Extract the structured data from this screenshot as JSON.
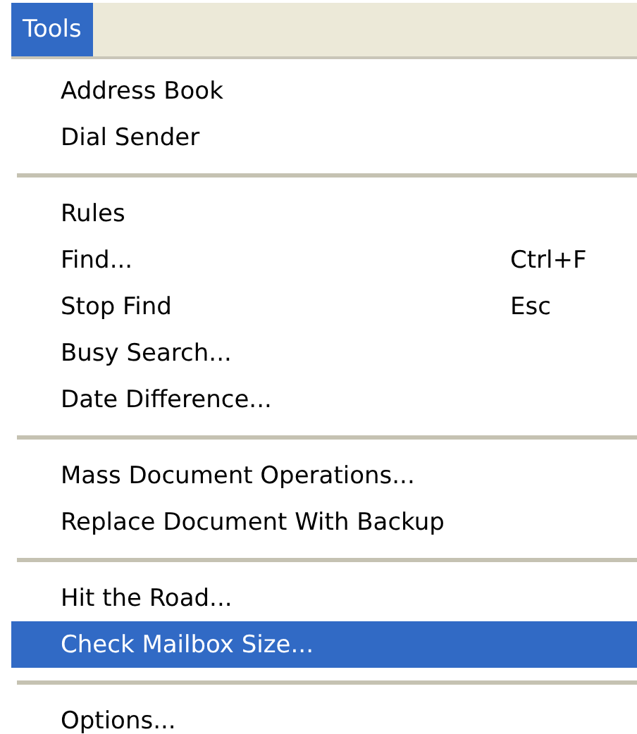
{
  "menu_bar": [
    {
      "label": "Tools",
      "selected": true
    }
  ],
  "menu": {
    "items": [
      {
        "kind": "item",
        "label": "Address Book",
        "selected": false
      },
      {
        "kind": "item",
        "label": "Dial Sender",
        "selected": false
      },
      {
        "kind": "separator"
      },
      {
        "kind": "item",
        "label": "Rules",
        "selected": false
      },
      {
        "kind": "item",
        "label": "Find...",
        "shortcut": "Ctrl+F",
        "selected": false
      },
      {
        "kind": "item",
        "label": "Stop Find",
        "shortcut": "Esc",
        "selected": false
      },
      {
        "kind": "item",
        "label": "Busy Search...",
        "selected": false
      },
      {
        "kind": "item",
        "label": "Date Difference...",
        "selected": false
      },
      {
        "kind": "separator"
      },
      {
        "kind": "item",
        "label": "Mass Document Operations...",
        "selected": false
      },
      {
        "kind": "item",
        "label": "Replace Document With Backup",
        "selected": false
      },
      {
        "kind": "separator"
      },
      {
        "kind": "item",
        "label": "Hit the Road...",
        "selected": false
      },
      {
        "kind": "item",
        "label": "Check Mailbox Size...",
        "selected": true
      },
      {
        "kind": "separator"
      },
      {
        "kind": "item",
        "label": "Options...",
        "selected": false
      }
    ]
  }
}
